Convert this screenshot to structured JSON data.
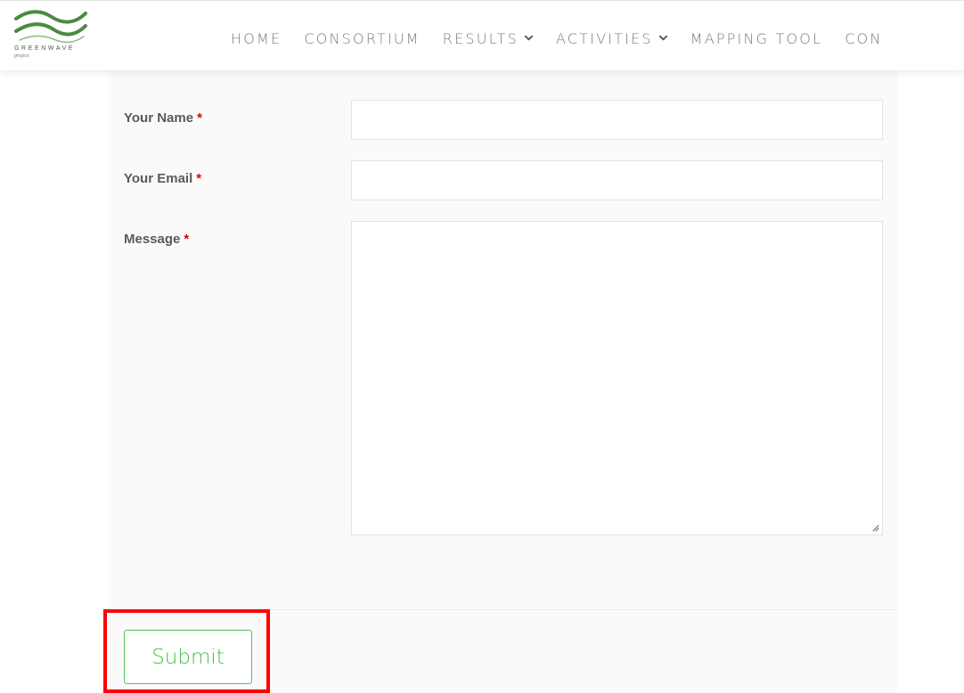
{
  "brand": {
    "name": "GREENWAVE",
    "tagline": "project",
    "color": "#4a8c3f"
  },
  "nav": {
    "items": [
      {
        "label": "HOME",
        "has_dropdown": false
      },
      {
        "label": "CONSORTIUM",
        "has_dropdown": false
      },
      {
        "label": "RESULTS",
        "has_dropdown": true
      },
      {
        "label": "ACTIVITIES",
        "has_dropdown": true
      },
      {
        "label": "MAPPING TOOL",
        "has_dropdown": false
      },
      {
        "label": "CON",
        "has_dropdown": false
      }
    ],
    "dropdown_icon": "chevron-down-icon"
  },
  "form": {
    "fields": [
      {
        "label": "Your Name",
        "required_marker": "*",
        "value": ""
      },
      {
        "label": "Your Email",
        "required_marker": "*",
        "value": ""
      },
      {
        "label": "Message",
        "required_marker": "*",
        "value": ""
      }
    ],
    "submit_label": "Submit"
  },
  "colors": {
    "required": "#e00000",
    "submit_accent": "#45c045",
    "highlight": "#ff0000"
  }
}
